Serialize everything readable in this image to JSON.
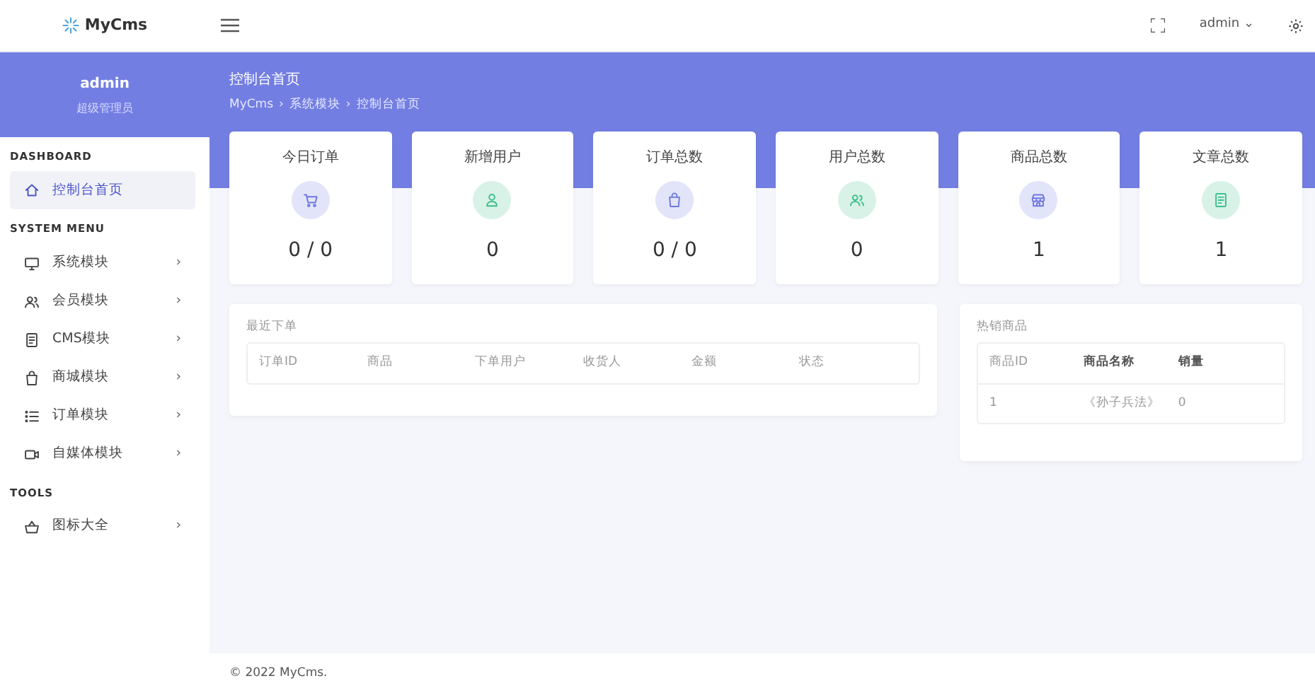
{
  "brand": "MyCms",
  "topbar": {
    "user": "admin",
    "caret": "⌄"
  },
  "profile": {
    "name": "admin",
    "role": "超级管理员"
  },
  "sidebar": [
    {
      "heading": "DASHBOARD",
      "items": [
        {
          "kind": "home",
          "label": "控制台首页",
          "selected": true
        }
      ]
    },
    {
      "heading": "SYSTEM MENU",
      "items": [
        {
          "kind": "monitor",
          "label": "系统模块",
          "chevron": "›",
          "selected": false
        },
        {
          "kind": "users",
          "label": "会员模块",
          "chevron": "›",
          "selected": false
        },
        {
          "kind": "doc",
          "label": "CMS模块",
          "chevron": "›",
          "selected": false
        },
        {
          "kind": "bag",
          "label": "商城模块",
          "chevron": "›",
          "selected": false
        },
        {
          "kind": "list",
          "label": "订单模块",
          "chevron": "›",
          "selected": false
        },
        {
          "kind": "video",
          "label": "自媒体模块",
          "chevron": "›",
          "selected": false
        }
      ]
    },
    {
      "heading": "TOOLS",
      "items": [
        {
          "kind": "basket",
          "label": "图标大全",
          "chevron": "›",
          "selected": false
        }
      ]
    }
  ],
  "page": {
    "title": "控制台首页",
    "breadcrumb": [
      "MyCms",
      "系统模块",
      "控制台首页"
    ],
    "separator": "›"
  },
  "stats": [
    {
      "label": "今日订单",
      "kind": "cart",
      "color": "#7078e0",
      "value": "0 / 0"
    },
    {
      "label": "新增用户",
      "kind": "user",
      "color": "#3cbf8c",
      "value": "0"
    },
    {
      "label": "订单总数",
      "kind": "bag",
      "color": "#7078e0",
      "value": "0 / 0"
    },
    {
      "label": "用户总数",
      "kind": "users",
      "color": "#3cbf8c",
      "value": "0"
    },
    {
      "label": "商品总数",
      "kind": "shop",
      "color": "#7078e0",
      "value": "1"
    },
    {
      "label": "文章总数",
      "kind": "doc",
      "color": "#3cbf8c",
      "value": "1"
    }
  ],
  "recent_orders": {
    "title": "最近下单",
    "columns": [
      "订单ID",
      "商品",
      "下单用户",
      "收货人",
      "金额",
      "状态"
    ]
  },
  "hot_products": {
    "title": "热销商品",
    "columns": [
      "商品ID",
      "商品名称",
      "销量"
    ],
    "rows": [
      [
        "1",
        "《孙子兵法》",
        "0"
      ]
    ]
  },
  "footer": "© 2022 MyCms."
}
